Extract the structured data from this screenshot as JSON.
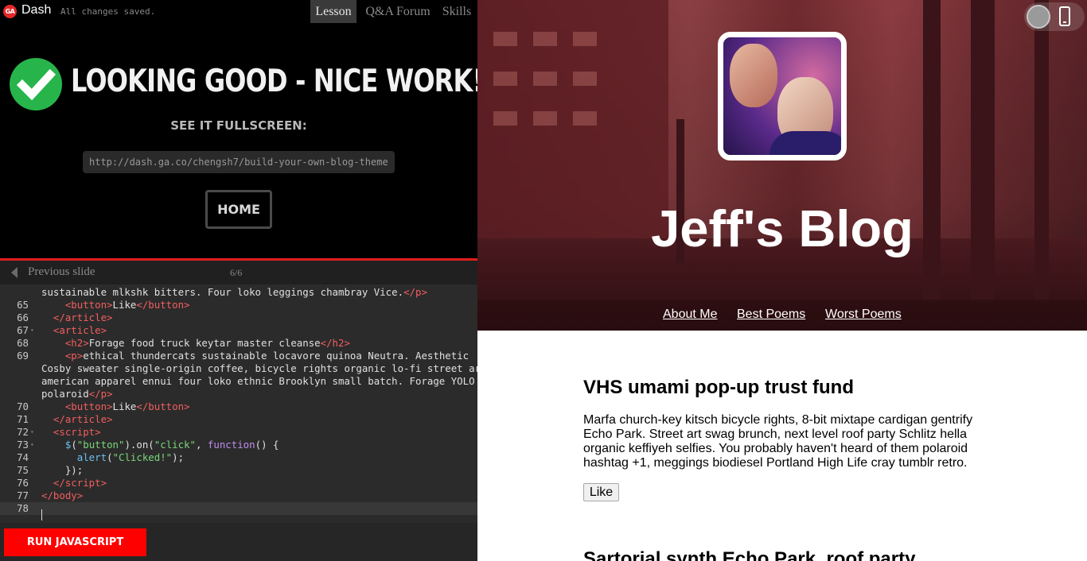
{
  "topbar": {
    "logo_text": "GA",
    "app_name": "Dash",
    "save_status": "All changes saved.",
    "tabs": [
      {
        "label": "Lesson",
        "active": true
      },
      {
        "label": "Q&A Forum",
        "active": false
      },
      {
        "label": "Skills",
        "active": false
      }
    ]
  },
  "success": {
    "icon": "check-circle-icon",
    "title": "LOOKING GOOD - NICE WORK!",
    "fullscreen_label": "SEE IT FULLSCREEN:",
    "url": "http://dash.ga.co/chengsh7/build-your-own-blog-theme",
    "home_label": "HOME"
  },
  "slide_nav": {
    "prev_label": "Previous slide",
    "counter": "6/6"
  },
  "editor": {
    "lines": [
      {
        "num": "",
        "fold": false,
        "html": "<span>sustainable mlkshk bitters. Four loko leggings chambray Vice.</span><span class=\"t\">&lt;/p&gt;</span>"
      },
      {
        "num": "65",
        "fold": false,
        "html": "    <span class=\"t\">&lt;button&gt;</span>Like<span class=\"t\">&lt;/button&gt;</span>"
      },
      {
        "num": "66",
        "fold": false,
        "html": "  <span class=\"t\">&lt;/article&gt;</span>"
      },
      {
        "num": "67",
        "fold": true,
        "html": "  <span class=\"t\">&lt;article&gt;</span>"
      },
      {
        "num": "68",
        "fold": false,
        "html": "    <span class=\"t\">&lt;h2&gt;</span>Forage food truck keytar master cleanse<span class=\"t\">&lt;/h2&gt;</span>"
      },
      {
        "num": "69",
        "fold": false,
        "html": "    <span class=\"t\">&lt;p&gt;</span>ethical thundercats sustainable locavore quinoa Neutra. Aesthetic"
      },
      {
        "num": "",
        "fold": false,
        "html": "Cosby sweater single-origin coffee, bicycle rights organic lo-fi street art"
      },
      {
        "num": "",
        "fold": false,
        "html": "american apparel ennui four loko ethnic Brooklyn small batch. Forage YOLO"
      },
      {
        "num": "",
        "fold": false,
        "html": "polaroid<span class=\"t\">&lt;/p&gt;</span>"
      },
      {
        "num": "70",
        "fold": false,
        "html": "    <span class=\"t\">&lt;button&gt;</span>Like<span class=\"t\">&lt;/button&gt;</span>"
      },
      {
        "num": "71",
        "fold": false,
        "html": "  <span class=\"t\">&lt;/article&gt;</span>"
      },
      {
        "num": "72",
        "fold": true,
        "html": "  <span class=\"t\">&lt;script&gt;</span>"
      },
      {
        "num": "73",
        "fold": true,
        "html": "    <span class=\"f\">$</span>(<span class=\"s\">\"button\"</span>).on(<span class=\"s\">\"click\"</span>, <span class=\"k\">function</span>() {"
      },
      {
        "num": "74",
        "fold": false,
        "html": "      <span class=\"f\">alert</span>(<span class=\"s\">\"Clicked!\"</span>);"
      },
      {
        "num": "75",
        "fold": false,
        "html": "    });"
      },
      {
        "num": "76",
        "fold": false,
        "html": "  <span class=\"t\">&lt;/script&gt;</span>"
      },
      {
        "num": "77",
        "fold": false,
        "html": "<span class=\"t\">&lt;/body&gt;</span>"
      },
      {
        "num": "78",
        "fold": false,
        "html": ""
      }
    ],
    "run_label": "RUN JAVASCRIPT"
  },
  "preview": {
    "device_toggle": {
      "knob": "toggle-knob",
      "icon": "phone-icon"
    },
    "blog_title": "Jeff's Blog",
    "nav": [
      "About Me",
      "Best Poems",
      "Worst Poems"
    ],
    "post1": {
      "title": "VHS umami pop-up trust fund",
      "body": "Marfa church-key kitsch bicycle rights, 8-bit mixtape cardigan gentrify Echo Park. Street art swag brunch, next level roof party Schlitz hella organic keffiyeh selfies. You probably haven't heard of them polaroid hashtag +1, meggings biodiesel Portland High Life cray tumblr retro.",
      "like_label": "Like"
    },
    "post2": {
      "title": "Sartorial synth Echo Park, roof party"
    }
  },
  "colors": {
    "accent_red": "#e11d1d",
    "run_button": "#ff0000",
    "success_green": "#27b54b",
    "code_tag": "#f25e5e",
    "code_string": "#7ad67a",
    "code_keyword": "#c28cf0",
    "code_function": "#6cc0f0"
  }
}
